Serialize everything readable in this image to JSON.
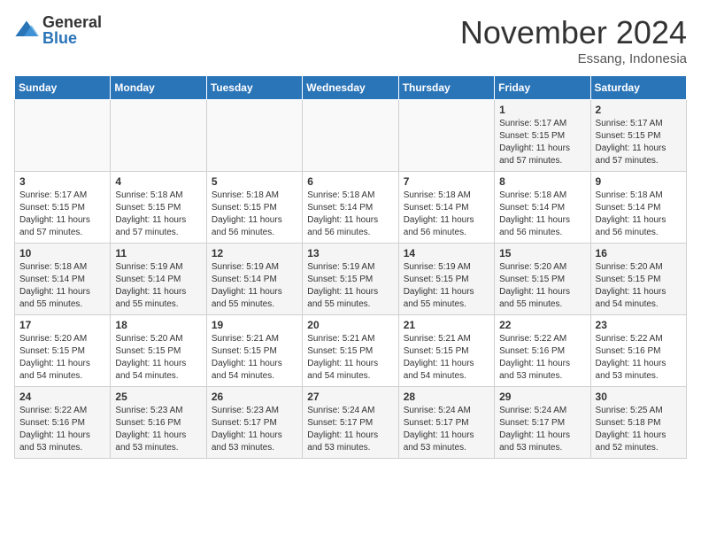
{
  "logo": {
    "general": "General",
    "blue": "Blue"
  },
  "header": {
    "month": "November 2024",
    "location": "Essang, Indonesia"
  },
  "weekdays": [
    "Sunday",
    "Monday",
    "Tuesday",
    "Wednesday",
    "Thursday",
    "Friday",
    "Saturday"
  ],
  "weeks": [
    [
      {
        "day": "",
        "info": ""
      },
      {
        "day": "",
        "info": ""
      },
      {
        "day": "",
        "info": ""
      },
      {
        "day": "",
        "info": ""
      },
      {
        "day": "",
        "info": ""
      },
      {
        "day": "1",
        "info": "Sunrise: 5:17 AM\nSunset: 5:15 PM\nDaylight: 11 hours\nand 57 minutes."
      },
      {
        "day": "2",
        "info": "Sunrise: 5:17 AM\nSunset: 5:15 PM\nDaylight: 11 hours\nand 57 minutes."
      }
    ],
    [
      {
        "day": "3",
        "info": "Sunrise: 5:17 AM\nSunset: 5:15 PM\nDaylight: 11 hours\nand 57 minutes."
      },
      {
        "day": "4",
        "info": "Sunrise: 5:18 AM\nSunset: 5:15 PM\nDaylight: 11 hours\nand 57 minutes."
      },
      {
        "day": "5",
        "info": "Sunrise: 5:18 AM\nSunset: 5:15 PM\nDaylight: 11 hours\nand 56 minutes."
      },
      {
        "day": "6",
        "info": "Sunrise: 5:18 AM\nSunset: 5:14 PM\nDaylight: 11 hours\nand 56 minutes."
      },
      {
        "day": "7",
        "info": "Sunrise: 5:18 AM\nSunset: 5:14 PM\nDaylight: 11 hours\nand 56 minutes."
      },
      {
        "day": "8",
        "info": "Sunrise: 5:18 AM\nSunset: 5:14 PM\nDaylight: 11 hours\nand 56 minutes."
      },
      {
        "day": "9",
        "info": "Sunrise: 5:18 AM\nSunset: 5:14 PM\nDaylight: 11 hours\nand 56 minutes."
      }
    ],
    [
      {
        "day": "10",
        "info": "Sunrise: 5:18 AM\nSunset: 5:14 PM\nDaylight: 11 hours\nand 55 minutes."
      },
      {
        "day": "11",
        "info": "Sunrise: 5:19 AM\nSunset: 5:14 PM\nDaylight: 11 hours\nand 55 minutes."
      },
      {
        "day": "12",
        "info": "Sunrise: 5:19 AM\nSunset: 5:14 PM\nDaylight: 11 hours\nand 55 minutes."
      },
      {
        "day": "13",
        "info": "Sunrise: 5:19 AM\nSunset: 5:15 PM\nDaylight: 11 hours\nand 55 minutes."
      },
      {
        "day": "14",
        "info": "Sunrise: 5:19 AM\nSunset: 5:15 PM\nDaylight: 11 hours\nand 55 minutes."
      },
      {
        "day": "15",
        "info": "Sunrise: 5:20 AM\nSunset: 5:15 PM\nDaylight: 11 hours\nand 55 minutes."
      },
      {
        "day": "16",
        "info": "Sunrise: 5:20 AM\nSunset: 5:15 PM\nDaylight: 11 hours\nand 54 minutes."
      }
    ],
    [
      {
        "day": "17",
        "info": "Sunrise: 5:20 AM\nSunset: 5:15 PM\nDaylight: 11 hours\nand 54 minutes."
      },
      {
        "day": "18",
        "info": "Sunrise: 5:20 AM\nSunset: 5:15 PM\nDaylight: 11 hours\nand 54 minutes."
      },
      {
        "day": "19",
        "info": "Sunrise: 5:21 AM\nSunset: 5:15 PM\nDaylight: 11 hours\nand 54 minutes."
      },
      {
        "day": "20",
        "info": "Sunrise: 5:21 AM\nSunset: 5:15 PM\nDaylight: 11 hours\nand 54 minutes."
      },
      {
        "day": "21",
        "info": "Sunrise: 5:21 AM\nSunset: 5:15 PM\nDaylight: 11 hours\nand 54 minutes."
      },
      {
        "day": "22",
        "info": "Sunrise: 5:22 AM\nSunset: 5:16 PM\nDaylight: 11 hours\nand 53 minutes."
      },
      {
        "day": "23",
        "info": "Sunrise: 5:22 AM\nSunset: 5:16 PM\nDaylight: 11 hours\nand 53 minutes."
      }
    ],
    [
      {
        "day": "24",
        "info": "Sunrise: 5:22 AM\nSunset: 5:16 PM\nDaylight: 11 hours\nand 53 minutes."
      },
      {
        "day": "25",
        "info": "Sunrise: 5:23 AM\nSunset: 5:16 PM\nDaylight: 11 hours\nand 53 minutes."
      },
      {
        "day": "26",
        "info": "Sunrise: 5:23 AM\nSunset: 5:17 PM\nDaylight: 11 hours\nand 53 minutes."
      },
      {
        "day": "27",
        "info": "Sunrise: 5:24 AM\nSunset: 5:17 PM\nDaylight: 11 hours\nand 53 minutes."
      },
      {
        "day": "28",
        "info": "Sunrise: 5:24 AM\nSunset: 5:17 PM\nDaylight: 11 hours\nand 53 minutes."
      },
      {
        "day": "29",
        "info": "Sunrise: 5:24 AM\nSunset: 5:17 PM\nDaylight: 11 hours\nand 53 minutes."
      },
      {
        "day": "30",
        "info": "Sunrise: 5:25 AM\nSunset: 5:18 PM\nDaylight: 11 hours\nand 52 minutes."
      }
    ]
  ]
}
